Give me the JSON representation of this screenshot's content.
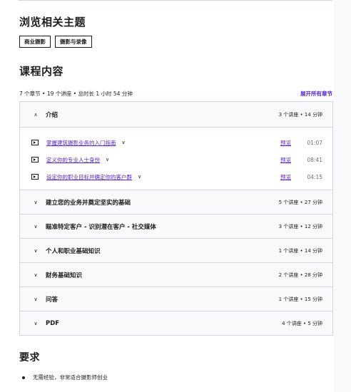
{
  "browse": {
    "title": "浏览相关主题",
    "topics": [
      "商业摄影",
      "摄影与录像"
    ]
  },
  "content": {
    "title": "课程内容",
    "summary": "7 个章节 • 19 个讲座 • 总时长 1 小时 54 分钟",
    "expand_all": "展开所有章节",
    "sections": [
      {
        "title": "介绍",
        "meta": "3 个讲座 • 14 分钟",
        "expanded": true,
        "lectures": [
          {
            "title": "掌握建筑摄影业务的入门指南",
            "preview": "预览",
            "duration": "01:07"
          },
          {
            "title": "定义你的专业人士身份",
            "preview": "预览",
            "duration": "08:41"
          },
          {
            "title": "设定你的职业目标并确定你的客户群",
            "preview": "预览",
            "duration": "04:15"
          }
        ]
      },
      {
        "title": "建立您的业务并奠定坚实的基础",
        "meta": "5 个讲座 • 27 分钟",
        "expanded": false
      },
      {
        "title": "瞄准特定客户 - 识别潜在客户 - 社交媒体",
        "meta": "3 个讲座 • 12 分钟",
        "expanded": false
      },
      {
        "title": "个人和职业基础知识",
        "meta": "1 个讲座 • 14 分钟",
        "expanded": false
      },
      {
        "title": "财务基础知识",
        "meta": "2 个讲座 • 28 分钟",
        "expanded": false
      },
      {
        "title": "问答",
        "meta": "1 个讲座 • 15 分钟",
        "expanded": false
      },
      {
        "title": "PDF",
        "meta": "4 个讲座 • 5 分钟",
        "expanded": false
      }
    ]
  },
  "requirements": {
    "title": "要求",
    "items": [
      "无需经验，非常适合摄影师创业"
    ]
  },
  "icons": {
    "expanded": "chevron-up-icon",
    "collapsed": "chevron-down-icon",
    "lecture": "video-icon",
    "bullet": "bullet-icon"
  },
  "colors": {
    "link": "#5624d0",
    "section_bg": "#f7f9fa",
    "border": "#d1d7dc",
    "text": "#1c1d1f",
    "muted": "#6a6f73"
  }
}
